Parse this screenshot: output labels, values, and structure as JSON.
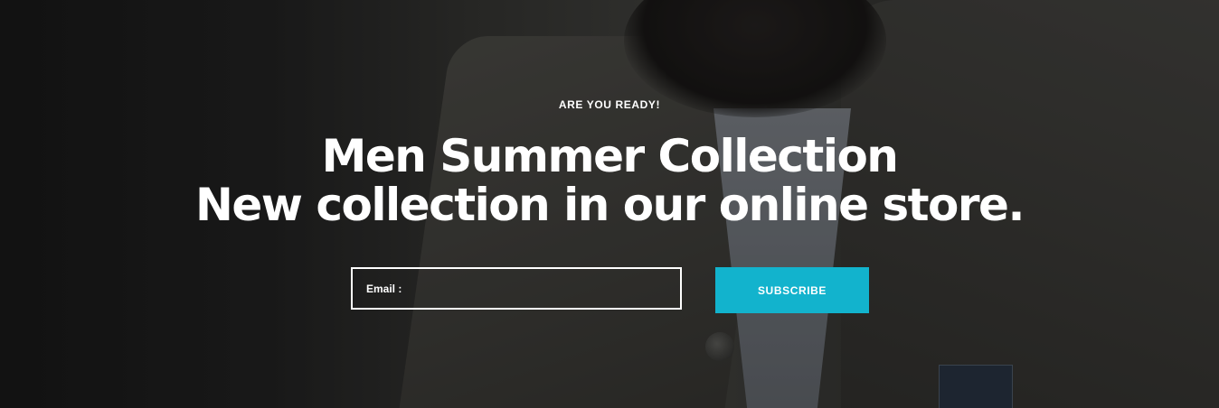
{
  "hero": {
    "eyebrow": "ARE YOU READY!",
    "headline_line1": "Men Summer Collection",
    "headline_line2": "New collection in our online store."
  },
  "subscribe_form": {
    "email_placeholder": "Email :",
    "email_value": "",
    "button_label": "SUBSCRIBE"
  },
  "colors": {
    "accent": "#12b3cd",
    "text": "#ffffff"
  }
}
